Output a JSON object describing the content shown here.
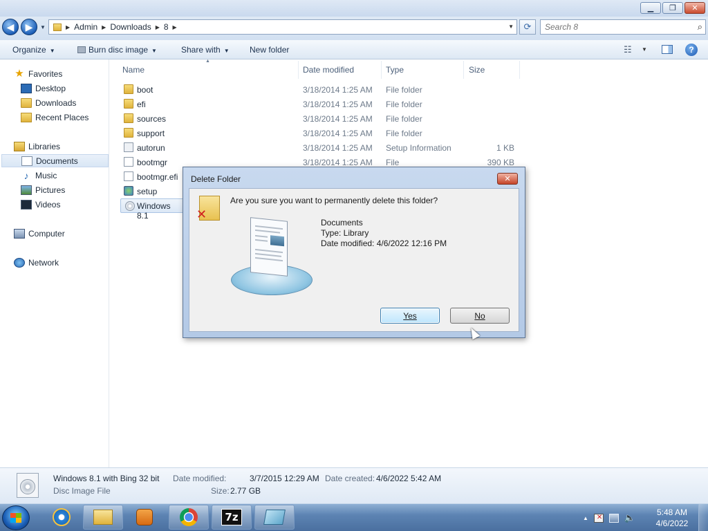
{
  "window": {
    "minimize_glyph": "▁",
    "maximize_glyph": "❐",
    "close_glyph": "✕"
  },
  "navigation": {
    "back_glyph": "◀",
    "forward_glyph": "▶",
    "recent_glyph": "▼",
    "breadcrumbs": [
      "Admin",
      "Downloads",
      "8"
    ],
    "breadcrumb_separator": "▶",
    "address_dropdown_glyph": "▼",
    "refresh_glyph": "⟳",
    "search_placeholder": "Search 8",
    "search_value": "",
    "search_icon": "search-icon"
  },
  "toolbar": {
    "organize": "Organize",
    "burn": "Burn disc image",
    "share": "Share with",
    "new_folder": "New folder",
    "caret": "▼",
    "views_glyph": "☷",
    "help_glyph": "?"
  },
  "sidebar": {
    "favorites": "Favorites",
    "desktop": "Desktop",
    "downloads": "Downloads",
    "recent": "Recent Places",
    "libraries": "Libraries",
    "documents": "Documents",
    "music": "Music",
    "pictures": "Pictures",
    "videos": "Videos",
    "computer": "Computer",
    "network": "Network",
    "star_glyph": "★",
    "music_glyph": "♪"
  },
  "filelist": {
    "columns": [
      "Name",
      "Date modified",
      "Type",
      "Size"
    ],
    "sort_glyph": "▲",
    "rows": [
      {
        "name": "boot",
        "date": "3/18/2014 1:25 AM",
        "type": "File folder",
        "size": "",
        "icon": "folder-icon"
      },
      {
        "name": "efi",
        "date": "3/18/2014 1:25 AM",
        "type": "File folder",
        "size": "",
        "icon": "folder-icon"
      },
      {
        "name": "sources",
        "date": "3/18/2014 1:25 AM",
        "type": "File folder",
        "size": "",
        "icon": "folder-icon"
      },
      {
        "name": "support",
        "date": "3/18/2014 1:25 AM",
        "type": "File folder",
        "size": "",
        "icon": "folder-icon"
      },
      {
        "name": "autorun",
        "date": "3/18/2014 1:25 AM",
        "type": "Setup Information",
        "size": "1 KB",
        "icon": "setup-info-icon"
      },
      {
        "name": "bootmgr",
        "date": "3/18/2014 1:25 AM",
        "type": "File",
        "size": "390 KB",
        "icon": "file-icon"
      },
      {
        "name": "bootmgr.efi",
        "date": "",
        "type": "",
        "size": "",
        "icon": "file-icon"
      },
      {
        "name": "setup",
        "date": "",
        "type": "",
        "size": "",
        "icon": "setup-icon"
      },
      {
        "name": "Windows 8.1",
        "date": "",
        "type": "",
        "size": "",
        "icon": "disc-image-icon"
      }
    ]
  },
  "details": {
    "name": "Windows 8.1 with Bing 32 bit",
    "kind": "Disc Image File",
    "modified_label": "Date modified:",
    "modified_value": "3/7/2015 12:29 AM",
    "size_label": "Size:",
    "size_value": "2.77 GB",
    "created_label": "Date created:",
    "created_value": "4/6/2022 5:42 AM"
  },
  "dialog": {
    "title": "Delete Folder",
    "close_glyph": "✕",
    "x_glyph": "✕",
    "question": "Are you sure you want to permanently delete this folder?",
    "item_name": "Documents",
    "item_type": "Type: Library",
    "item_modified": "Date modified: 4/6/2022 12:16 PM",
    "yes": "Yes",
    "no": "No"
  },
  "taskbar": {
    "apps": [
      "internet-explorer",
      "windows-explorer",
      "media-player",
      "chrome",
      "7-zip",
      "other-app"
    ],
    "sevenzip_label": "7z",
    "tray_arrow": "▲",
    "volume_glyph": "🔈",
    "time": "5:48 AM",
    "date": "4/6/2022"
  }
}
